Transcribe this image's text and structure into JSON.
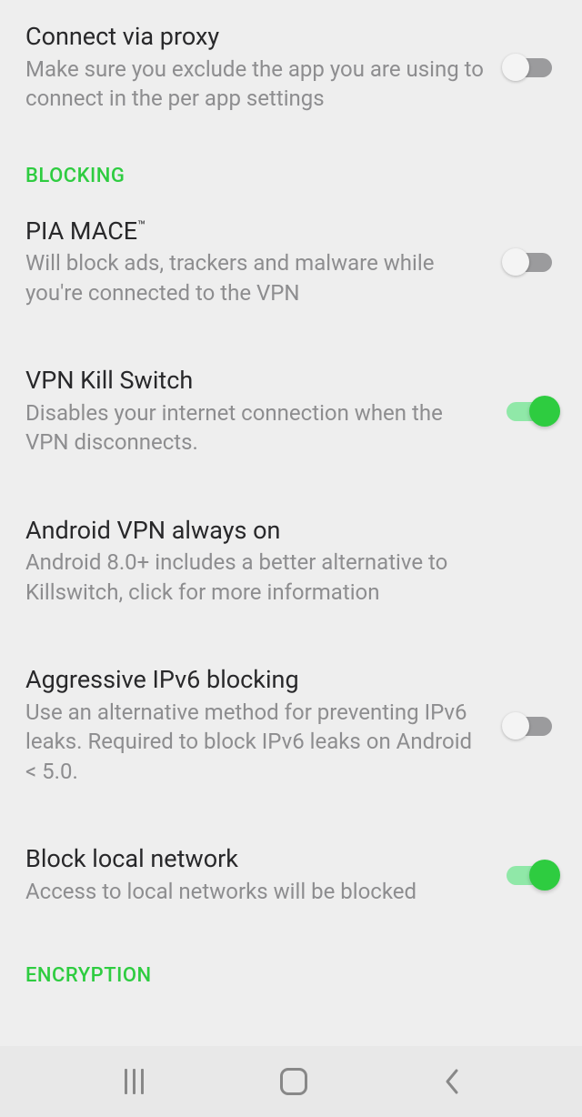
{
  "items": [
    {
      "title": "Connect via proxy",
      "sub": "Make sure you exclude the app you are using to connect in the per app settings",
      "toggle": "off"
    }
  ],
  "section1": "BLOCKING",
  "blocking": [
    {
      "title": "PIA MACE",
      "tm": "™",
      "sub": "Will block ads, trackers and malware while you're connected to the VPN",
      "toggle": "off"
    },
    {
      "title": "VPN Kill Switch",
      "sub": "Disables your internet connection when the VPN disconnects.",
      "toggle": "on"
    },
    {
      "title": "Android VPN always on",
      "sub": "Android 8.0+ includes a better alternative to Killswitch, click for more information",
      "toggle": "none"
    },
    {
      "title": "Aggressive IPv6 blocking",
      "sub": "Use an alternative method for preventing IPv6 leaks. Required to block IPv6 leaks on Android < 5.0.",
      "toggle": "off"
    },
    {
      "title": "Block local network",
      "sub": "Access to local networks will be blocked",
      "toggle": "on"
    }
  ],
  "section2": "ENCRYPTION"
}
